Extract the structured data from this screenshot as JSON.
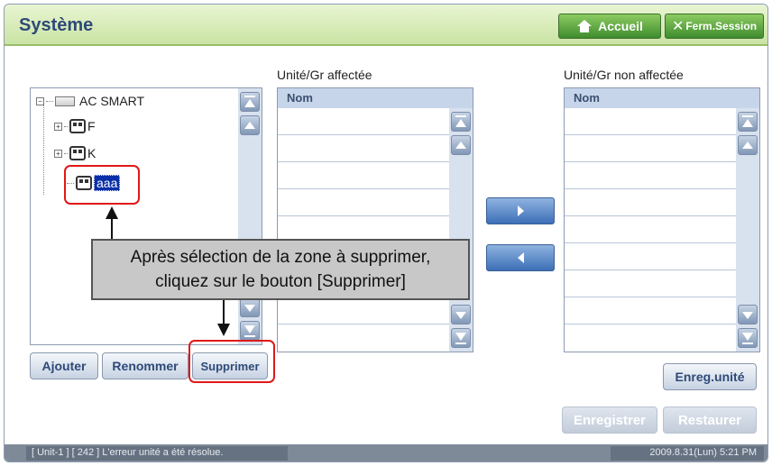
{
  "header": {
    "title": "Système",
    "home_label": "Accueil",
    "logout_label": "Ferm.Session"
  },
  "tree": {
    "root_label": "AC SMART",
    "items": [
      {
        "label": "F"
      },
      {
        "label": "K"
      },
      {
        "label": "aaa",
        "selected": true
      }
    ]
  },
  "assigned": {
    "title": "Unité/Gr affectée",
    "column": "Nom"
  },
  "unassigned": {
    "title": "Unité/Gr non affectée",
    "column": "Nom"
  },
  "buttons": {
    "add": "Ajouter",
    "rename": "Renommer",
    "delete": "Supprimer",
    "save_unit": "Enreg.unité",
    "save": "Enregistrer",
    "restore": "Restaurer"
  },
  "callout": {
    "line1": "Après sélection de la zone à supprimer,",
    "line2": "cliquez sur le bouton [Supprimer]"
  },
  "status": {
    "message": "[ Unit-1 ] [ 242 ] L'erreur unité a été résolue.",
    "datetime": "2009.8.31(Lun)  5:21 PM"
  }
}
